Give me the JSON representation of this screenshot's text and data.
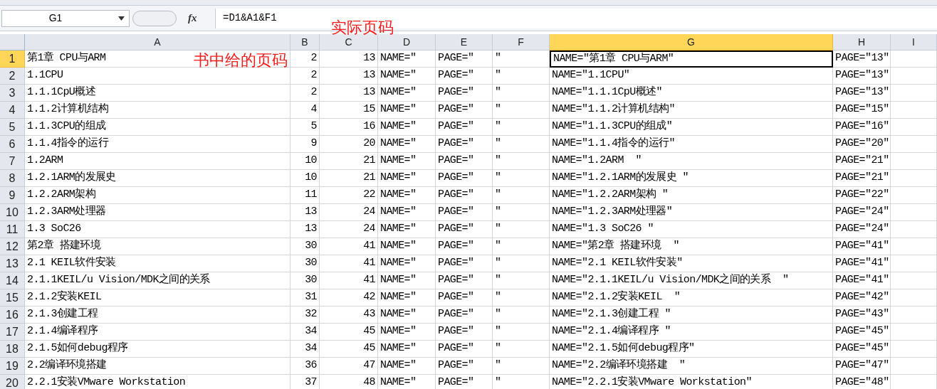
{
  "name_box": "G1",
  "function_label": "fx",
  "formula": "=D1&A1&F1",
  "columns": [
    {
      "label": "A",
      "kind": "text",
      "selected": false
    },
    {
      "label": "B",
      "kind": "number",
      "selected": false
    },
    {
      "label": "C",
      "kind": "number",
      "selected": false
    },
    {
      "label": "D",
      "kind": "text",
      "selected": false
    },
    {
      "label": "E",
      "kind": "text",
      "selected": false
    },
    {
      "label": "F",
      "kind": "text",
      "selected": false
    },
    {
      "label": "G",
      "kind": "text",
      "selected": true
    },
    {
      "label": "H",
      "kind": "text",
      "selected": false
    },
    {
      "label": "I",
      "kind": "text",
      "selected": false
    }
  ],
  "rows": [
    {
      "number": "1",
      "selected": true,
      "cells": [
        "第1章 CPU与ARM",
        "2",
        "13",
        "NAME=″",
        "PAGE=″",
        "″",
        "NAME=″第1章 CPU与ARM″",
        "PAGE=″13″"
      ]
    },
    {
      "number": "2",
      "selected": false,
      "cells": [
        "1.1CPU",
        "2",
        "13",
        "NAME=″",
        "PAGE=″",
        "″",
        "NAME=″1.1CPU″",
        "PAGE=″13″"
      ]
    },
    {
      "number": "3",
      "selected": false,
      "cells": [
        "1.1.1CpU概述",
        "2",
        "13",
        "NAME=″",
        "PAGE=″",
        "″",
        "NAME=″1.1.1CpU概述″",
        "PAGE=″13″"
      ]
    },
    {
      "number": "4",
      "selected": false,
      "cells": [
        "1.1.2计算机结构",
        "4",
        "15",
        "NAME=″",
        "PAGE=″",
        "″",
        "NAME=″1.1.2计算机结构″",
        "PAGE=″15″"
      ]
    },
    {
      "number": "5",
      "selected": false,
      "cells": [
        "1.1.3CPU的组成",
        "5",
        "16",
        "NAME=″",
        "PAGE=″",
        "″",
        "NAME=″1.1.3CPU的组成″",
        "PAGE=″16″"
      ]
    },
    {
      "number": "6",
      "selected": false,
      "cells": [
        "1.1.4指令的运行",
        "9",
        "20",
        "NAME=″",
        "PAGE=″",
        "″",
        "NAME=″1.1.4指令的运行″",
        "PAGE=″20″"
      ]
    },
    {
      "number": "7",
      "selected": false,
      "cells": [
        "1.2ARM",
        "10",
        "21",
        "NAME=″",
        "PAGE=″",
        "″",
        "NAME=″1.2ARM  ″",
        "PAGE=″21″"
      ]
    },
    {
      "number": "8",
      "selected": false,
      "cells": [
        "1.2.1ARM的发展史",
        "10",
        "21",
        "NAME=″",
        "PAGE=″",
        "″",
        "NAME=″1.2.1ARM的发展史 ″",
        "PAGE=″21″"
      ]
    },
    {
      "number": "9",
      "selected": false,
      "cells": [
        "1.2.2ARM架构",
        "11",
        "22",
        "NAME=″",
        "PAGE=″",
        "″",
        "NAME=″1.2.2ARM架构 ″",
        "PAGE=″22″"
      ]
    },
    {
      "number": "10",
      "selected": false,
      "cells": [
        "1.2.3ARM处理器",
        "13",
        "24",
        "NAME=″",
        "PAGE=″",
        "″",
        "NAME=″1.2.3ARM处理器″",
        "PAGE=″24″"
      ]
    },
    {
      "number": "11",
      "selected": false,
      "cells": [
        "1.3 SoC26",
        "13",
        "24",
        "NAME=″",
        "PAGE=″",
        "″",
        "NAME=″1.3 SoC26 ″",
        "PAGE=″24″"
      ]
    },
    {
      "number": "12",
      "selected": false,
      "cells": [
        "第2章 搭建环境",
        "30",
        "41",
        "NAME=″",
        "PAGE=″",
        "″",
        "NAME=″第2章 搭建环境  ″",
        "PAGE=″41″"
      ]
    },
    {
      "number": "13",
      "selected": false,
      "cells": [
        "2.1 KEIL软件安装",
        "30",
        "41",
        "NAME=″",
        "PAGE=″",
        "″",
        "NAME=″2.1 KEIL软件安装″",
        "PAGE=″41″"
      ]
    },
    {
      "number": "14",
      "selected": false,
      "cells": [
        "2.1.1KEIL/u Vision/MDK之间的关系",
        "30",
        "41",
        "NAME=″",
        "PAGE=″",
        "″",
        "NAME=″2.1.1KEIL/u Vision/MDK之间的关系  ″",
        "PAGE=″41″"
      ]
    },
    {
      "number": "15",
      "selected": false,
      "cells": [
        "2.1.2安装KEIL",
        "31",
        "42",
        "NAME=″",
        "PAGE=″",
        "″",
        "NAME=″2.1.2安装KEIL  ″",
        "PAGE=″42″"
      ]
    },
    {
      "number": "16",
      "selected": false,
      "cells": [
        "2.1.3创建工程",
        "32",
        "43",
        "NAME=″",
        "PAGE=″",
        "″",
        "NAME=″2.1.3创建工程 ″",
        "PAGE=″43″"
      ]
    },
    {
      "number": "17",
      "selected": false,
      "cells": [
        "2.1.4编译程序",
        "34",
        "45",
        "NAME=″",
        "PAGE=″",
        "″",
        "NAME=″2.1.4编译程序 ″",
        "PAGE=″45″"
      ]
    },
    {
      "number": "18",
      "selected": false,
      "cells": [
        "2.1.5如何debug程序",
        "34",
        "45",
        "NAME=″",
        "PAGE=″",
        "″",
        "NAME=″2.1.5如何debug程序″",
        "PAGE=″45″"
      ]
    },
    {
      "number": "19",
      "selected": false,
      "cells": [
        "2.2编译环境搭建",
        "36",
        "47",
        "NAME=″",
        "PAGE=″",
        "″",
        "NAME=″2.2编译环境搭建  ″",
        "PAGE=″47″"
      ]
    },
    {
      "number": "20",
      "selected": false,
      "cells": [
        "2.2.1安装VMware Workstation",
        "37",
        "48",
        "NAME=″",
        "PAGE=″",
        "″",
        "NAME=″2.2.1安装VMware Workstation″",
        "PAGE=″48″"
      ]
    }
  ],
  "annotations": [
    "实际页码",
    "书中给的页码"
  ]
}
